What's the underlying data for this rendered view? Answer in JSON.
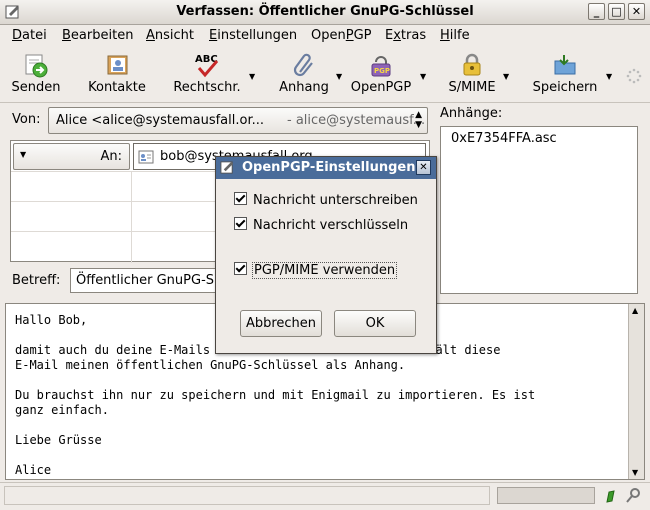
{
  "window": {
    "title": "Verfassen: Öffentlicher GnuPG-Schlüssel",
    "btn_minimize": "_",
    "btn_maximize": "□",
    "btn_close": "✕"
  },
  "menu": [
    {
      "pre": "",
      "u": "D",
      "post": "atei"
    },
    {
      "pre": "",
      "u": "B",
      "post": "earbeiten"
    },
    {
      "pre": "",
      "u": "A",
      "post": "nsicht"
    },
    {
      "pre": "",
      "u": "E",
      "post": "instellungen"
    },
    {
      "pre": "Open",
      "u": "P",
      "post": "GP"
    },
    {
      "pre": "E",
      "u": "x",
      "post": "tras"
    },
    {
      "pre": "",
      "u": "H",
      "post": "ilfe"
    }
  ],
  "toolbar": {
    "send": "Senden",
    "contacts": "Kontakte",
    "spell": "Rechtschr.",
    "spell_badge": "ABC",
    "attach": "Anhang",
    "openpgp": "OpenPGP",
    "openpgp_badge": "PGP",
    "smime": "S/MIME",
    "save": "Speichern"
  },
  "compose": {
    "from_label": "Von:",
    "from_value": "Alice <alice@systemausfall.or...",
    "from_account": "- alice@systemausf...",
    "recipient_type": "An:",
    "recipient": "bob@systemausfall.org",
    "subject_label": "Betreff:",
    "subject_value": "Öffentlicher GnuPG-S"
  },
  "attachments": {
    "label": "Anhänge:",
    "items": [
      "0xE7354FFA.asc"
    ]
  },
  "body_lines": [
    "Hallo Bob,",
    "",
    "damit auch du deine E-Mails a",
    "E-Mail meinen öffentlichen GnuPG-Schlüssel als Anhang.",
    "",
    "Du brauchst ihn nur zu speichern und mit Enigmail zu importieren. Es ist",
    "ganz einfach.",
    "",
    "Liebe Grüsse",
    "",
    "Alice"
  ],
  "body_tail": "thält diese",
  "dialog": {
    "title": "OpenPGP-Einstellungen",
    "close": "✕",
    "sign_label": "Nachricht unterschreiben",
    "encrypt_label": "Nachricht verschlüsseln",
    "pgpmime_label": "PGP/MIME verwenden",
    "cancel": "Abbrechen",
    "ok": "OK"
  },
  "colors": {
    "dialog_titlebar": "#4a6c9a",
    "window_bg": "#efebe7"
  }
}
